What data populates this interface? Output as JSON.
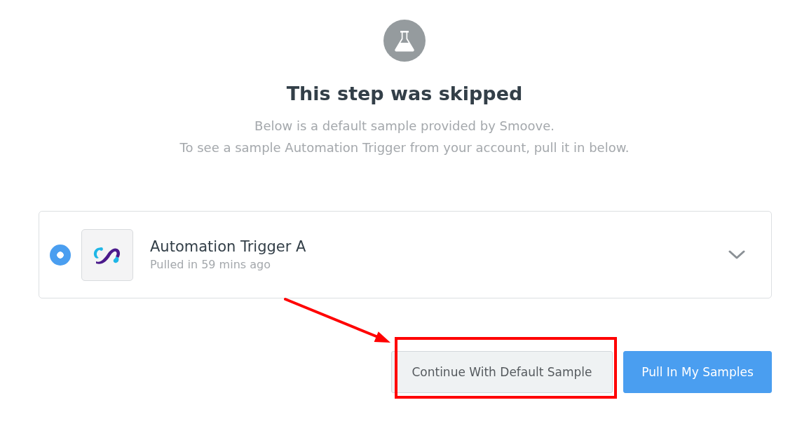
{
  "header": {
    "title": "This step was skipped",
    "description": [
      "Below is a default sample provided by Smoove.",
      "To see a sample Automation Trigger from your account, pull it in below."
    ]
  },
  "samples": [
    {
      "title": "Automation Trigger A",
      "subtitle": "Pulled in 59 mins ago",
      "selected": true,
      "expanded": false
    }
  ],
  "buttons": [
    {
      "label": "Continue With Default Sample",
      "kind": "secondary",
      "highlighted": true
    },
    {
      "label": "Pull In My Samples",
      "kind": "primary",
      "highlighted": false
    }
  ]
}
